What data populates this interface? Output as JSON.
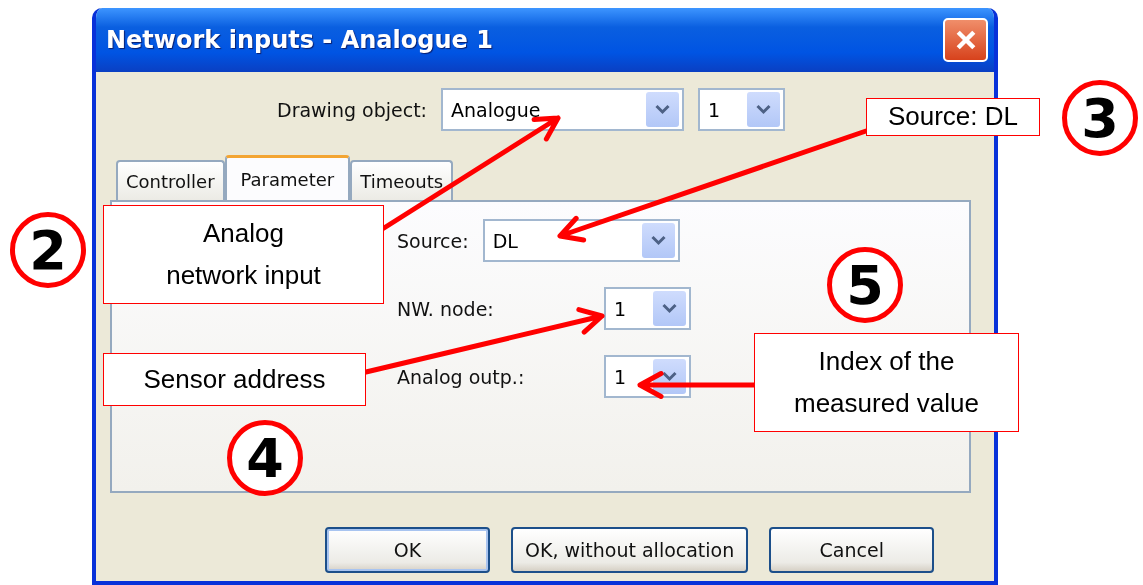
{
  "window": {
    "title": "Network inputs - Analogue 1"
  },
  "drawing_object": {
    "label": "Drawing object:",
    "value": "Analogue",
    "number": "1"
  },
  "tabs": [
    {
      "label": "Controller",
      "selected": false
    },
    {
      "label": "Parameter",
      "selected": true
    },
    {
      "label": "Timeouts",
      "selected": false
    }
  ],
  "fields": [
    {
      "label": "Source:",
      "value": "DL"
    },
    {
      "label": "NW. node:",
      "value": "1"
    },
    {
      "label": "Analog outp.:",
      "value": "1"
    }
  ],
  "buttons": [
    {
      "label": "OK",
      "default": true
    },
    {
      "label": "OK, without allocation",
      "default": false
    },
    {
      "label": "Cancel",
      "default": false
    }
  ],
  "annotations": [
    {
      "number": "2",
      "lines": [
        "Analog",
        "network input"
      ]
    },
    {
      "number": "3",
      "lines": [
        "Source: DL"
      ]
    },
    {
      "number": "4",
      "lines": [
        "Sensor address"
      ]
    },
    {
      "number": "5",
      "lines": [
        "Index of the",
        "measured value"
      ]
    }
  ]
}
